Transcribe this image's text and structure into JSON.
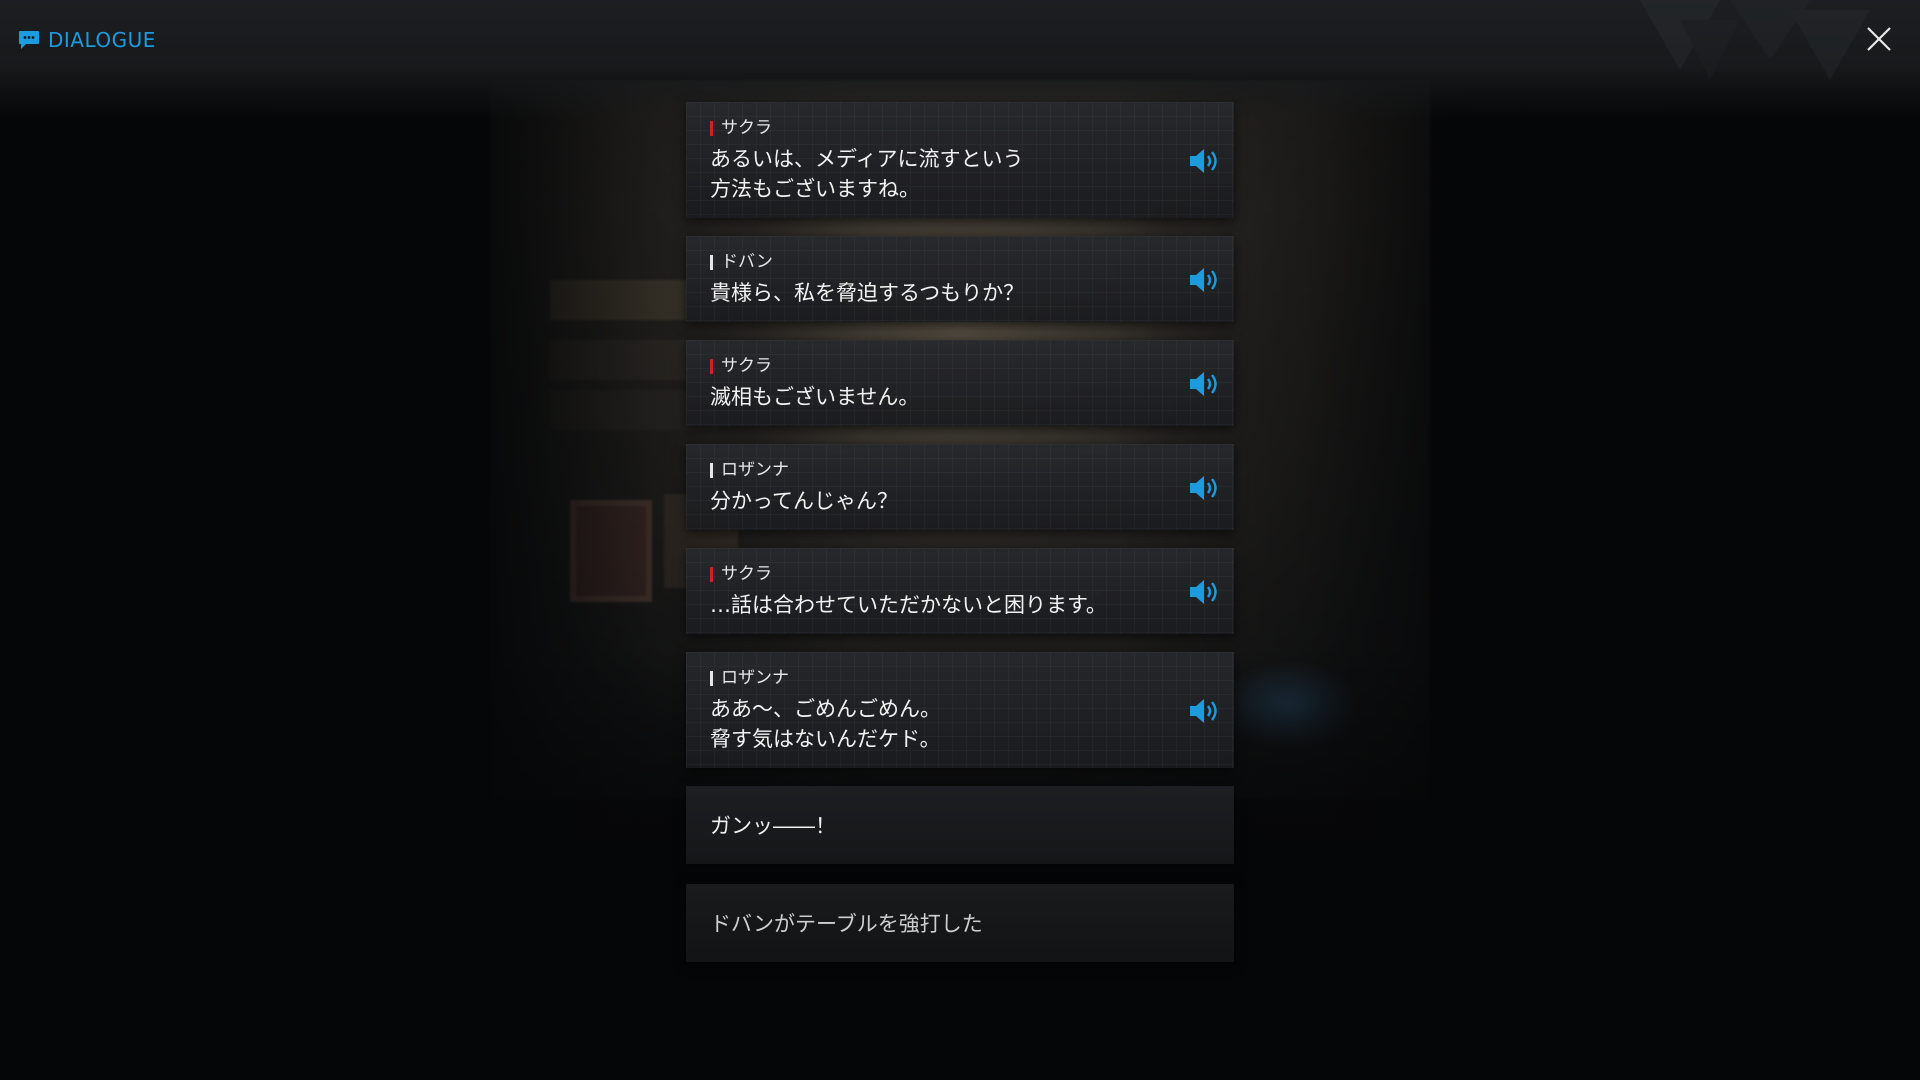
{
  "header": {
    "title": "DIALOGUE",
    "title_icon": "chat-bubble-icon",
    "close_icon": "close-icon",
    "accent_color": "#1d9bdf"
  },
  "entries": [
    {
      "speaker": "サクラ",
      "marker_color": "#d0202a",
      "text": "あるいは、メディアに流すという\n方法もございますね。",
      "voice_icon": "speaker-icon"
    },
    {
      "speaker": "ドバン",
      "marker_color": "#e6e6e6",
      "text": "貴様ら、私を脅迫するつもりか？",
      "voice_icon": "speaker-icon"
    },
    {
      "speaker": "サクラ",
      "marker_color": "#d0202a",
      "text": "滅相もございません。",
      "voice_icon": "speaker-icon"
    },
    {
      "speaker": "ロザンナ",
      "marker_color": "#e6e6e6",
      "text": "分かってんじゃん？",
      "voice_icon": "speaker-icon"
    },
    {
      "speaker": "サクラ",
      "marker_color": "#d0202a",
      "text": "…話は合わせていただかないと困ります。",
      "voice_icon": "speaker-icon"
    },
    {
      "speaker": "ロザンナ",
      "marker_color": "#e6e6e6",
      "text": "ああ～、ごめんごめん。\n脅す気はないんだケド。",
      "voice_icon": "speaker-icon"
    }
  ],
  "narration": [
    {
      "text": "ガンッ――！"
    },
    {
      "text": "ドバンがテーブルを強打した"
    }
  ]
}
